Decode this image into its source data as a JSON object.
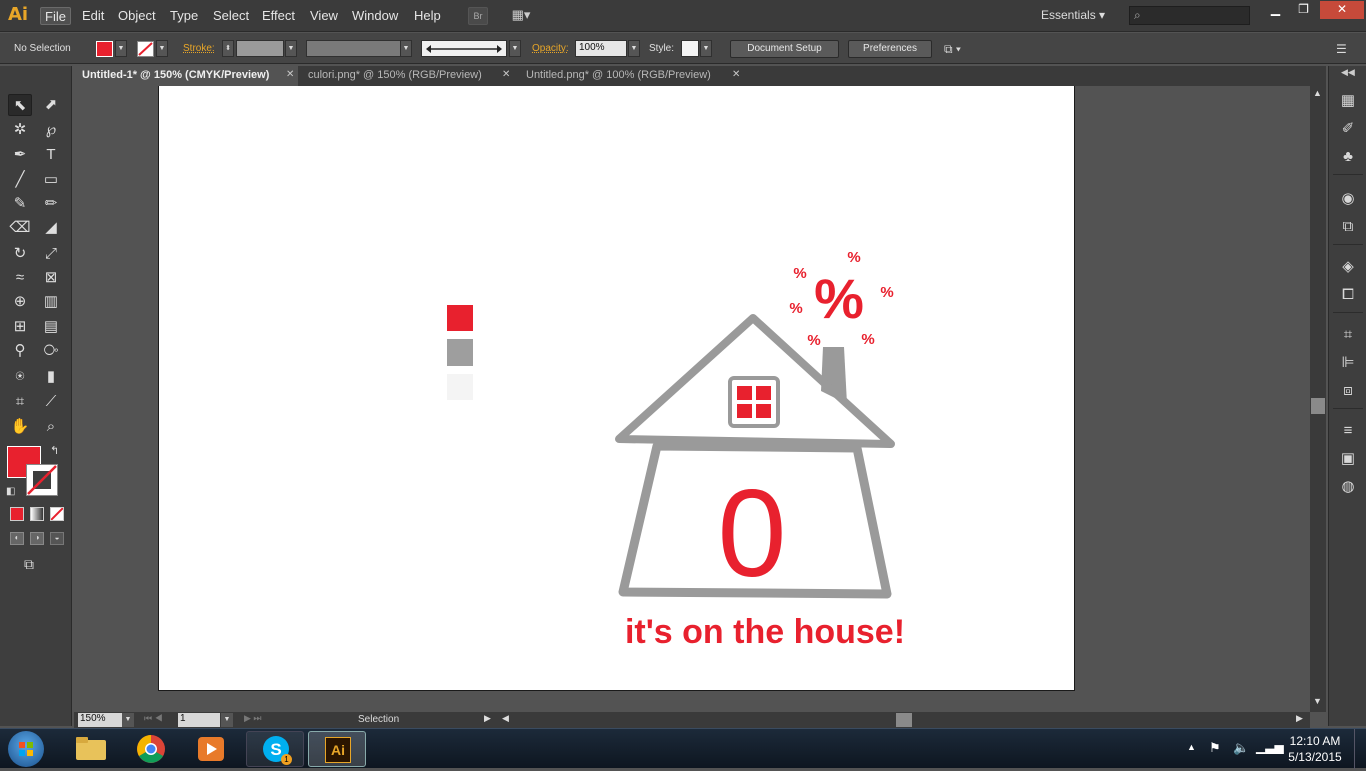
{
  "menubar": {
    "logo": "Ai",
    "items": [
      "File",
      "Edit",
      "Object",
      "Type",
      "Select",
      "Effect",
      "View",
      "Window",
      "Help"
    ],
    "bridge_btn": "Br",
    "workspace": "Essentials"
  },
  "controlbar": {
    "selection": "No Selection",
    "stroke_label": "Stroke:",
    "opacity_label": "Opacity:",
    "opacity_value": "100%",
    "style_label": "Style:",
    "document_setup": "Document Setup",
    "preferences": "Preferences"
  },
  "tabs": [
    {
      "label": "Untitled-1* @ 150% (CMYK/Preview)",
      "active": true
    },
    {
      "label": "culori.png* @ 150% (RGB/Preview)",
      "active": false
    },
    {
      "label": "Untitled.png* @ 100% (RGB/Preview)",
      "active": false
    }
  ],
  "artwork": {
    "zero": "0",
    "tagline": "it's on the house!",
    "percent_big": "%",
    "percent_small": "%",
    "accent": "#e8212e",
    "gray": "#999999",
    "swatch_red": "#e8212e",
    "swatch_gray": "#9e9e9e",
    "swatch_light": "#f4f4f4"
  },
  "statusbar": {
    "zoom": "150%",
    "artboard": "1",
    "tool": "Selection"
  },
  "taskbar": {
    "time": "12:10 AM",
    "date": "5/13/2015",
    "skype_badge": "1",
    "ai_label": "Ai"
  },
  "colors": {
    "fill": "#e8212e"
  }
}
